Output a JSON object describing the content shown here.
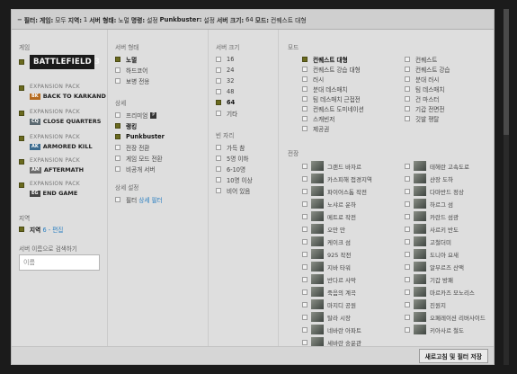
{
  "header": {
    "filter_label": "필터:",
    "game_label": "게임:",
    "game_value": "모두",
    "region_label": "지역:",
    "region_value": "1",
    "type_label": "서버 형태:",
    "type_value": "노멀",
    "mode_label": "명령:",
    "mode_value": "설정",
    "pb_label": "Punkbuster:",
    "pb_value": "설정",
    "size_label": "서버 크기:",
    "size_value": "64",
    "modes_label": "모드:",
    "modes_value": "컨퀘스트 대형"
  },
  "game_section": {
    "title": "게임",
    "logo": "BATTLEFIELD 3",
    "expansions": [
      {
        "tag": "EXPANSION PACK",
        "badge": "BK",
        "name": "BACK TO KARKAND",
        "checked": true
      },
      {
        "tag": "EXPANSION PACK",
        "badge": "CQ",
        "name": "CLOSE QUARTERS",
        "checked": true
      },
      {
        "tag": "EXPANSION PACK",
        "badge": "AK",
        "name": "ARMORED KILL",
        "checked": true
      },
      {
        "tag": "EXPANSION PACK",
        "badge": "AM",
        "name": "AFTERMATH",
        "checked": true
      },
      {
        "tag": "EXPANSION PACK",
        "badge": "EG",
        "name": "END GAME",
        "checked": true
      }
    ],
    "region_title": "지역",
    "region_item": "지역",
    "region_link": "6 - 편집",
    "search_title": "서버 이름으로 검색하기",
    "search_placeholder": "이름"
  },
  "server_type": {
    "title": "서버 형태",
    "items": [
      {
        "label": "노멀",
        "checked": true
      },
      {
        "label": "하드코어",
        "checked": false
      },
      {
        "label": "보병 전용",
        "checked": false
      }
    ],
    "detail_title": "상세",
    "details": [
      {
        "label": "프리미엄",
        "checked": false
      },
      {
        "label": "랭킹",
        "checked": true
      },
      {
        "label": "Punkbuster",
        "checked": true
      },
      {
        "label": "전장 전환",
        "checked": false
      },
      {
        "label": "게임 모드 전환",
        "checked": false
      },
      {
        "label": "비공개 서버",
        "checked": false
      }
    ],
    "advanced_title": "상세 설정",
    "advanced_prefix": "필터",
    "advanced_link": "상세 필터"
  },
  "server_size": {
    "title": "서버 크기",
    "items": [
      {
        "label": "16",
        "checked": false
      },
      {
        "label": "24",
        "checked": false
      },
      {
        "label": "32",
        "checked": false
      },
      {
        "label": "48",
        "checked": false
      },
      {
        "label": "64",
        "checked": true
      },
      {
        "label": "기타",
        "checked": false
      }
    ],
    "free_title": "빈 자리",
    "free_items": [
      {
        "label": "가득 참",
        "checked": false
      },
      {
        "label": "5명 이하",
        "checked": false
      },
      {
        "label": "6-10명",
        "checked": false
      },
      {
        "label": "10명 이상",
        "checked": false
      },
      {
        "label": "비어 있음",
        "checked": false
      }
    ]
  },
  "modes": {
    "title": "모드",
    "left": [
      {
        "label": "컨퀘스트 대형",
        "checked": true
      },
      {
        "label": "컨퀘스트 강습 대형",
        "checked": false
      },
      {
        "label": "러시",
        "checked": false
      },
      {
        "label": "분대 데스매치",
        "checked": false
      },
      {
        "label": "팀 데스매치 근접전",
        "checked": false
      },
      {
        "label": "컨퀘스트 도미네이션",
        "checked": false
      },
      {
        "label": "스캐빈저",
        "checked": false
      },
      {
        "label": "제공권",
        "checked": false
      }
    ],
    "right": [
      {
        "label": "컨퀘스트",
        "checked": false
      },
      {
        "label": "컨퀘스트 강습",
        "checked": false
      },
      {
        "label": "분대 러시",
        "checked": false
      },
      {
        "label": "팀 데스매치",
        "checked": false
      },
      {
        "label": "건 마스터",
        "checked": false
      },
      {
        "label": "기갑 전면전",
        "checked": false
      },
      {
        "label": "깃발 쟁탈",
        "checked": false
      }
    ]
  },
  "maps": {
    "title": "전장",
    "left": [
      "그랜드 바자르",
      "카스피해 접경지역",
      "파이어스톰 작전",
      "노샤르 운하",
      "메트로 작전",
      "오만 만",
      "케이크 섬",
      "925 작전",
      "지바 타워",
      "반다르 사막",
      "죽음의 계곡",
      "마지디 공원",
      "탈라 시장",
      "네바란 아파트",
      "세바란 숭윤관"
    ],
    "right": [
      "테헤란 고속도로",
      "샨장 도하",
      "다마반드 정상",
      "하르그 섬",
      "카란드 섬광",
      "사르키 반도",
      "고철더미",
      "도니아 요새",
      "알부르즈 산맥",
      "기갑 방패",
      "마르카즈 모노리스",
      "진원지",
      "오페레이션 리버사이드",
      "키아사르 철도"
    ]
  },
  "footer": {
    "save_label": "새로고침 및 필터 저장"
  }
}
